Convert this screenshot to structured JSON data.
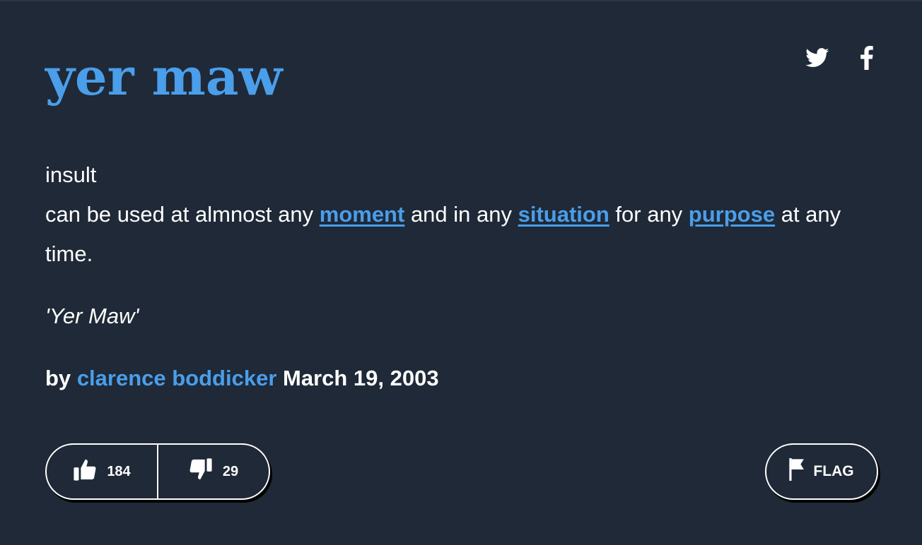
{
  "definition": {
    "word": "yer maw",
    "meaning": {
      "line1": "insult",
      "line2_part1": "can be used at almnost any ",
      "link1": "moment",
      "line2_part2": " and in any ",
      "link2": "situation",
      "line2_part3": " for any ",
      "link3": "purpose",
      "line2_part4": " at any time."
    },
    "example": "'Yer Maw'",
    "contributor": {
      "prefix": "by",
      "author": "clarence boddicker",
      "date": "March 19, 2003"
    },
    "votes": {
      "up": "184",
      "down": "29"
    },
    "flag_label": "FLAG"
  },
  "share": {
    "icons": [
      "twitter-icon",
      "facebook-icon"
    ]
  },
  "colors": {
    "background": "#1f2937",
    "accent": "#4a9eea",
    "text": "#ffffff"
  }
}
